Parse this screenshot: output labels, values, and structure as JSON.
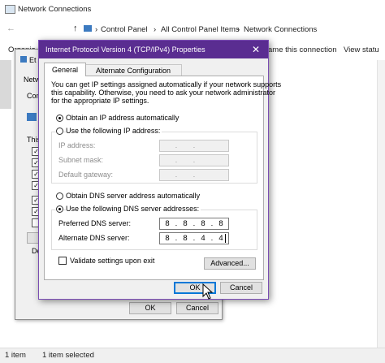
{
  "explorer": {
    "window_title": "Network Connections",
    "breadcrumbs": [
      "Control Panel",
      "All Control Panel Items",
      "Network Connections"
    ],
    "cmd_partial_left": "Organiz",
    "cmd_rename": "ame this connection",
    "cmd_view_status": "View statu",
    "status_items": "1 item",
    "status_selected": "1 item selected"
  },
  "ethernet_dialog": {
    "title_partial": "Et",
    "tab_partial": "Netw",
    "connect_partial": "Conn",
    "this_partial": "This",
    "desc_partial": "De",
    "ok_label": "OK",
    "cancel_label": "Cancel"
  },
  "ipv4_dialog": {
    "title": "Internet Protocol Version 4 (TCP/IPv4) Properties",
    "tabs": [
      "General",
      "Alternate Configuration"
    ],
    "intro_lines": [
      "You can get IP settings assigned automatically if your network supports",
      "this capability. Otherwise, you need to ask your network administrator",
      "for the appropriate IP settings."
    ],
    "radio_obtain_ip": "Obtain an IP address automatically",
    "radio_use_ip": "Use the following IP address:",
    "ip_address_label": "IP address:",
    "subnet_label": "Subnet mask:",
    "gateway_label": "Default gateway:",
    "radio_obtain_dns": "Obtain DNS server address automatically",
    "radio_use_dns": "Use the following DNS server addresses:",
    "preferred_dns_label": "Preferred DNS server:",
    "alternate_dns_label": "Alternate DNS server:",
    "preferred_dns": [
      "8",
      "8",
      "8",
      "8"
    ],
    "alternate_dns": [
      "8",
      "8",
      "4",
      "4"
    ],
    "validate_label": "Validate settings upon exit",
    "advanced_label": "Advanced...",
    "ok_label": "OK",
    "cancel_label": "Cancel",
    "selected_ip_option": "obtain_auto",
    "selected_dns_option": "use_following",
    "validate_checked": false
  },
  "colors": {
    "titlebar": "#5a2d91",
    "dialog_bg": "#f0f0f0",
    "focus_blue": "#0078d7"
  }
}
